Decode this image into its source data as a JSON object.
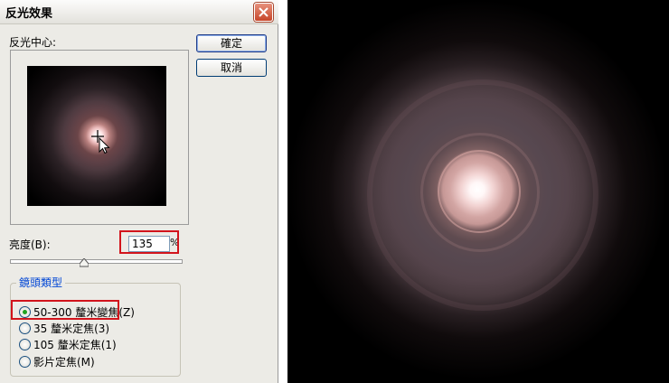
{
  "dialog": {
    "title": "反光效果",
    "ok_label": "確定",
    "cancel_label": "取消",
    "center_label": "反光中心:",
    "brightness_label": "亮度(B):",
    "brightness_value": "135",
    "percent": "%",
    "lens_group_label": "鏡頭類型",
    "lens_options": [
      {
        "label": "50-300 釐米變焦(Z)",
        "selected": true
      },
      {
        "label": "35 釐米定焦(3)",
        "selected": false
      },
      {
        "label": "105 釐米定焦(1)",
        "selected": false
      },
      {
        "label": "影片定焦(M)",
        "selected": false
      }
    ]
  },
  "colors": {
    "highlight_border": "#d2141c",
    "group_label": "#0046d5",
    "dialog_bg": "#ecebe6"
  }
}
